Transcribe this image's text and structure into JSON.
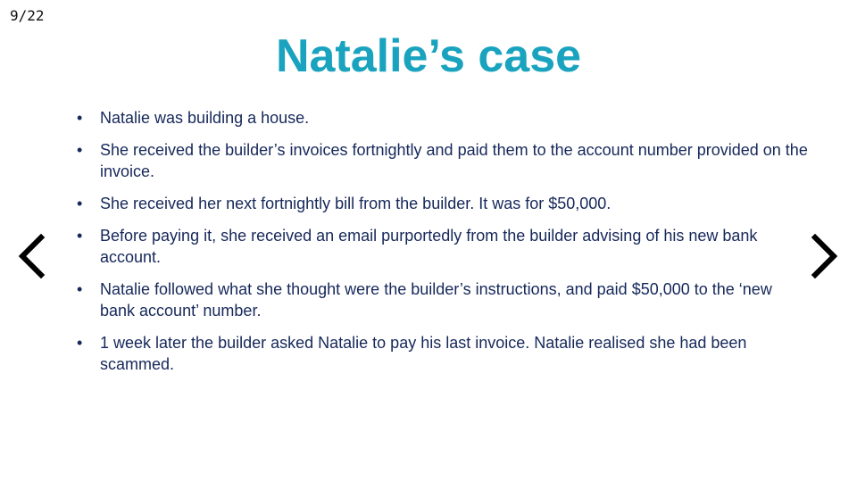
{
  "slide": {
    "counter": "9/22",
    "title": "Natalie’s case",
    "bullets": [
      "Natalie was building a house.",
      "She received the builder’s invoices fortnightly and paid them to the account number provided on the invoice.",
      "She received her next fortnightly bill from the builder. It was for $50,000.",
      "Before paying it, she received an email purportedly from the builder advising of his new bank account.",
      "Natalie followed what she thought were the builder’s instructions, and paid $50,000 to the ‘new bank account’ number.",
      "1 week later the builder asked Natalie to pay his last invoice. Natalie realised she had been scammed."
    ],
    "bullet_marker": "•"
  },
  "navigation": {
    "prev_icon": "chevron-left-icon",
    "next_icon": "chevron-right-icon"
  },
  "colors": {
    "title": "#1aa3bf",
    "body_text": "#16285a",
    "background": "#ffffff"
  }
}
